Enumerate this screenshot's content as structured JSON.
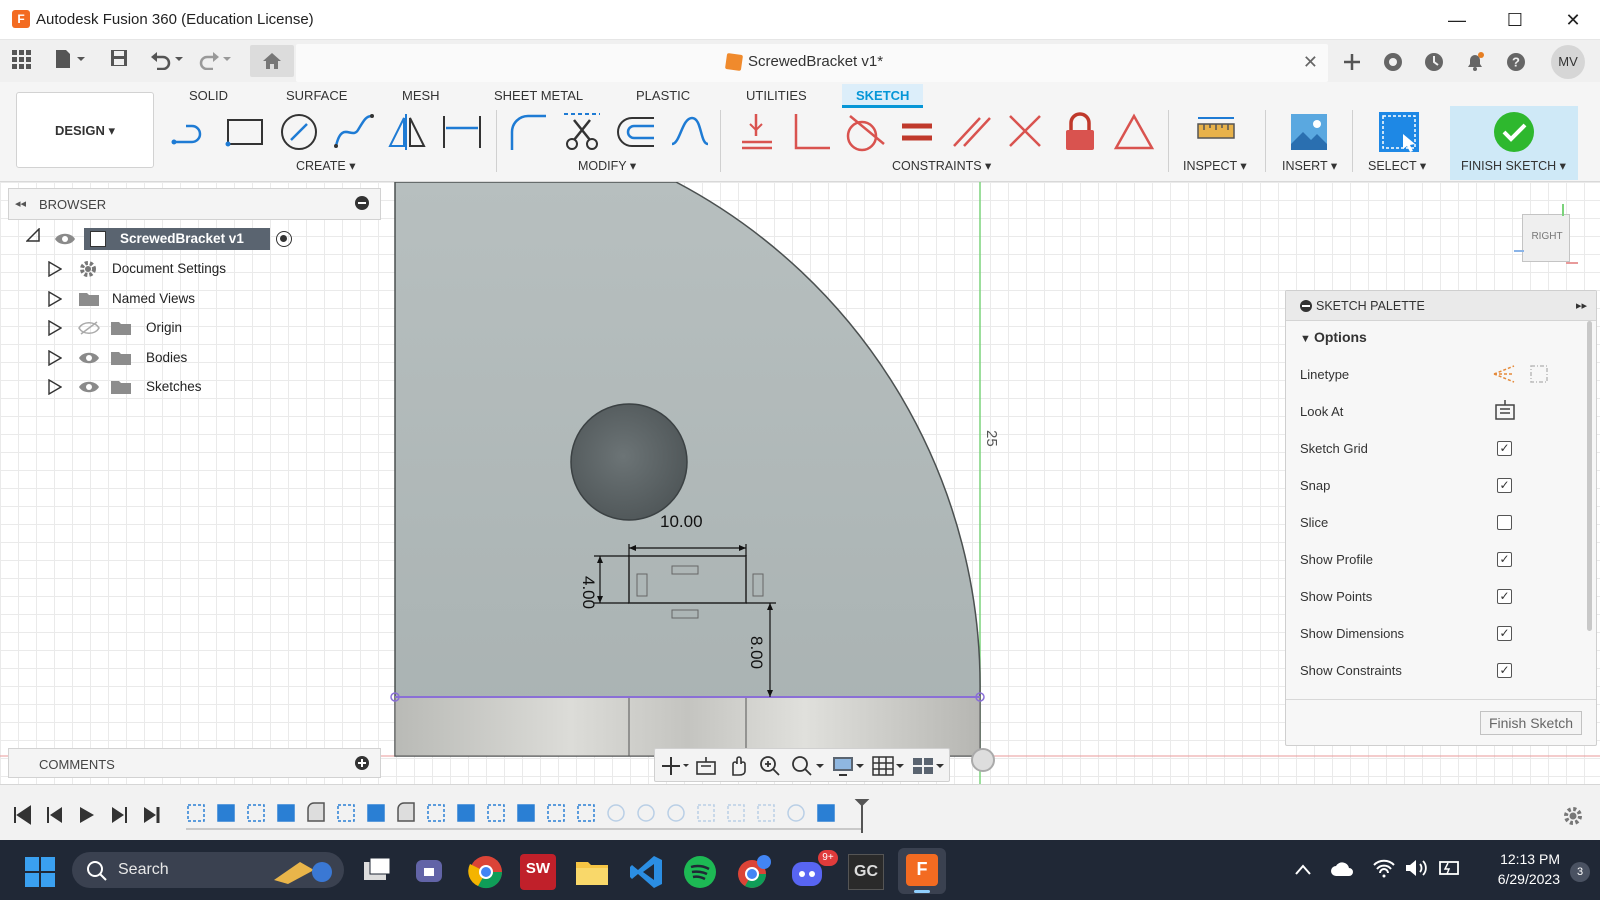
{
  "window": {
    "title": "Autodesk Fusion 360 (Education License)",
    "app_glyph": "F",
    "minimize": "—",
    "maximize": "☐",
    "close": "✕"
  },
  "document_tab": {
    "name": "ScrewedBracket v1*",
    "close": "✕"
  },
  "user": {
    "initials": "MV"
  },
  "ribbon": {
    "workspace": "DESIGN ▾",
    "tabs": [
      "SOLID",
      "SURFACE",
      "MESH",
      "SHEET METAL",
      "PLASTIC",
      "UTILITIES",
      "SKETCH"
    ],
    "active_tab": "SKETCH",
    "groups": {
      "create": "CREATE ▾",
      "modify": "MODIFY ▾",
      "constraints": "CONSTRAINTS ▾",
      "inspect": "INSPECT ▾",
      "insert": "INSERT ▾",
      "select": "SELECT ▾",
      "finish": "FINISH SKETCH ▾"
    }
  },
  "browser": {
    "title": "BROWSER",
    "root": "ScrewedBracket v1",
    "items": [
      {
        "label": "Document Settings",
        "icon": "gear-icon"
      },
      {
        "label": "Named Views",
        "icon": "folder-icon"
      },
      {
        "label": "Origin",
        "icon": "folder-icon"
      },
      {
        "label": "Bodies",
        "icon": "folder-icon"
      },
      {
        "label": "Sketches",
        "icon": "folder-icon"
      }
    ]
  },
  "comments": {
    "title": "COMMENTS"
  },
  "viewcube": {
    "face": "RIGHT"
  },
  "sketch": {
    "dim_width": "10.00",
    "dim_height": "4.00",
    "dim_offset": "8.00",
    "dim_axis": "25"
  },
  "palette": {
    "title": "SKETCH PALETTE",
    "section": "Options",
    "options": [
      {
        "label": "Linetype",
        "kind": "icons"
      },
      {
        "label": "Look At",
        "kind": "icon"
      },
      {
        "label": "Sketch Grid",
        "checked": true
      },
      {
        "label": "Snap",
        "checked": true
      },
      {
        "label": "Slice",
        "checked": false
      },
      {
        "label": "Show Profile",
        "checked": true
      },
      {
        "label": "Show Points",
        "checked": true
      },
      {
        "label": "Show Dimensions",
        "checked": true
      },
      {
        "label": "Show Constraints",
        "checked": true
      }
    ],
    "finish_button": "Finish Sketch"
  },
  "taskbar": {
    "search": "Search",
    "time": "12:13 PM",
    "date": "6/29/2023",
    "notification_count": "3",
    "discord_badge": "9+",
    "gc_label": "GC",
    "sw_label": "SW"
  },
  "colors": {
    "accent": "#0696d7",
    "finish_green": "#2eb82e",
    "constraint_red": "#d9534f",
    "body_fill": "#b4bcbc",
    "taskbar": "#202836"
  }
}
